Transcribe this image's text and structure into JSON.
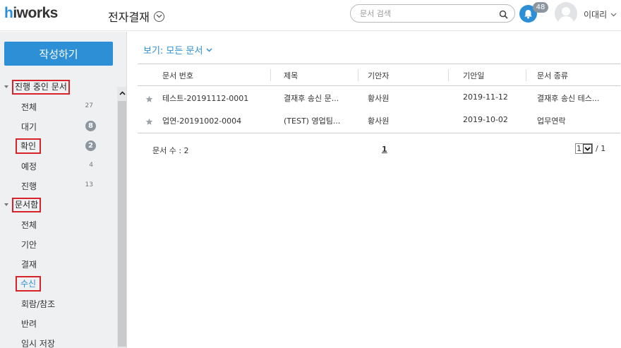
{
  "header": {
    "logo_h": "h",
    "logo_rest": "iworks",
    "app_title": "전자결재",
    "search_placeholder": "문서 검색",
    "notification_count": "48",
    "username": "이대리"
  },
  "sidebar": {
    "write_button": "작성하기",
    "section_in_progress": "진행 중인 문서",
    "in_progress_items": [
      {
        "label": "전체",
        "count": "27"
      },
      {
        "label": "대기",
        "count": "8"
      },
      {
        "label": "확인",
        "count": "2"
      },
      {
        "label": "예정",
        "count": "4"
      },
      {
        "label": "진행",
        "count": "13"
      }
    ],
    "section_box": "문서함",
    "box_items": [
      {
        "label": "전체"
      },
      {
        "label": "기안"
      },
      {
        "label": "결재"
      },
      {
        "label": "수신"
      },
      {
        "label": "회람/참조"
      },
      {
        "label": "반려"
      },
      {
        "label": "임시 저장"
      }
    ]
  },
  "main": {
    "view_label": "보기: 모든 문서",
    "columns": [
      "문서 번호",
      "제목",
      "기안자",
      "기안일",
      "문서 종류"
    ],
    "rows": [
      {
        "doc_no": "테스트-20191112-0001",
        "title": "결재후 송신 문...",
        "drafter": "황사원",
        "date": "2019-11-12",
        "type": "결재후 송신 테스..."
      },
      {
        "doc_no": "업연-20191002-0004",
        "title": "(TEST) 영업팀...",
        "drafter": "황사원",
        "date": "2019-10-02",
        "type": "업무연락"
      }
    ],
    "doc_count": "문서 수 : 2",
    "current_page": "1",
    "page_select_value": "1",
    "total_pages": "/ 1"
  },
  "colors": {
    "accent": "#2d8fd5",
    "highlight_box": "#d9232a",
    "badge": "#8c96a0"
  }
}
